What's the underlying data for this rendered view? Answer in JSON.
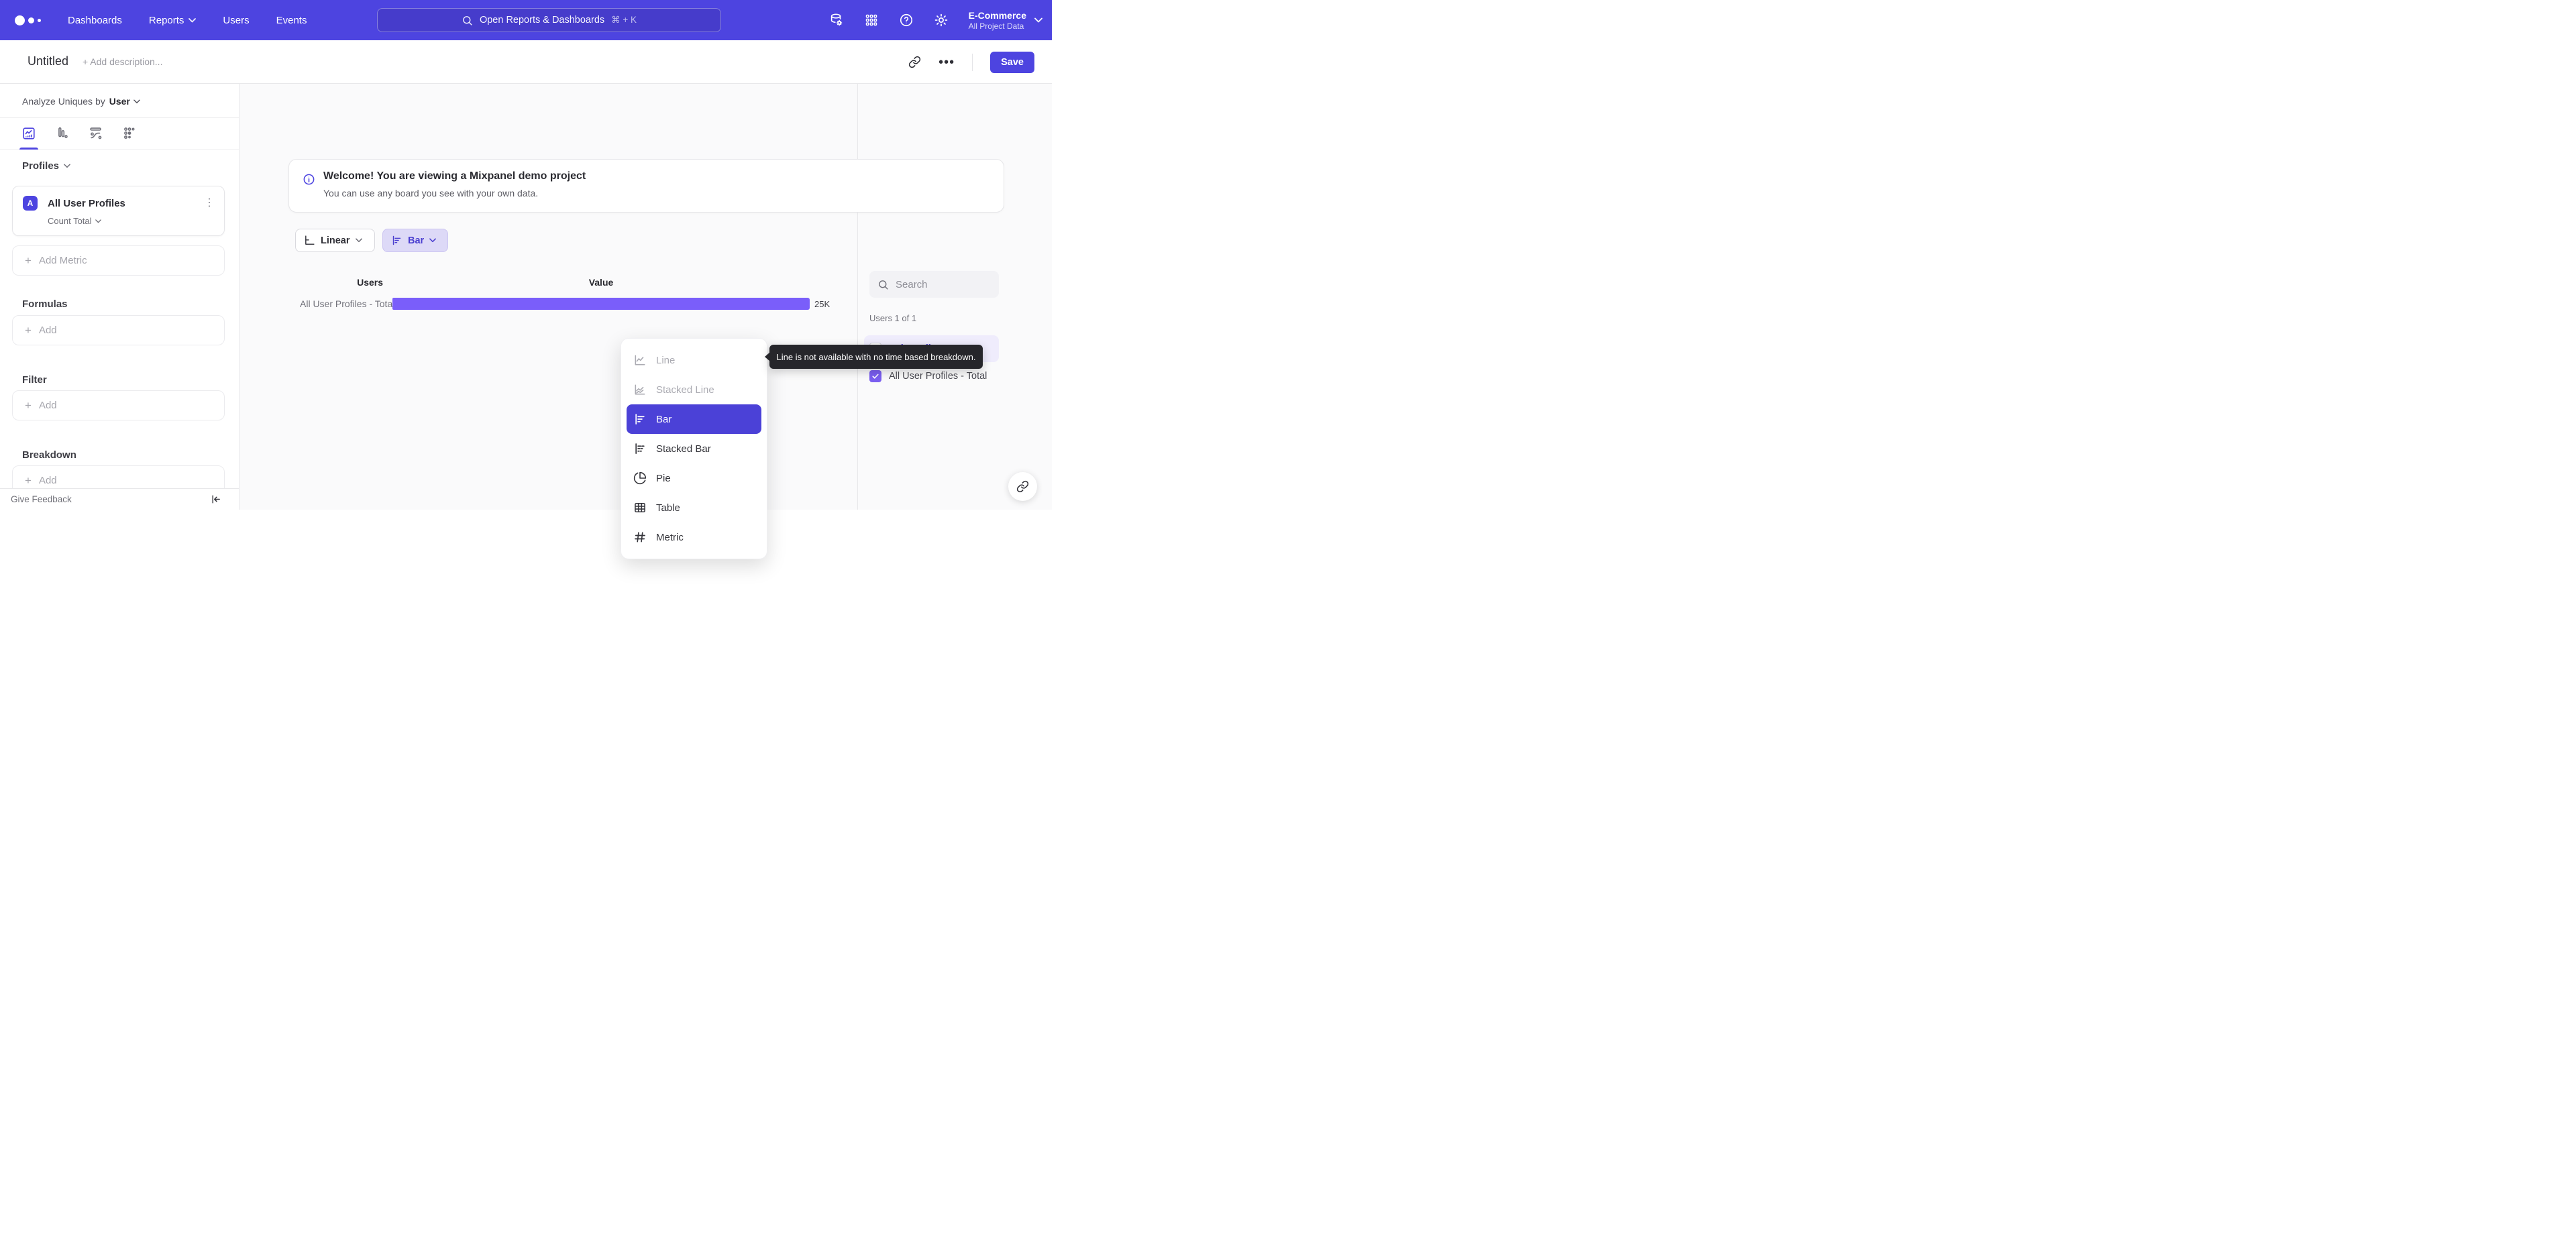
{
  "nav": {
    "items": [
      {
        "label": "Dashboards"
      },
      {
        "label": "Reports"
      },
      {
        "label": "Users"
      },
      {
        "label": "Events"
      }
    ],
    "search": {
      "placeholder": "Open Reports & Dashboards",
      "shortcut": "⌘ + K"
    },
    "project": {
      "name": "E-Commerce",
      "scope": "All Project Data"
    }
  },
  "header": {
    "title": "Untitled",
    "add_description": "+ Add description...",
    "more_label": "•••",
    "save_label": "Save"
  },
  "sidebar": {
    "analyze_prefix": "Analyze Uniques by",
    "analyze_selected": "User",
    "profiles_heading": "Profiles",
    "metric": {
      "letter": "A",
      "name": "All User Profiles",
      "aggregation": "Count Total",
      "kebab": "⋮"
    },
    "add_metric_label": "Add Metric",
    "plus": "+",
    "sections": [
      {
        "heading": "Formulas",
        "add_label": "Add"
      },
      {
        "heading": "Filter",
        "add_label": "Add"
      },
      {
        "heading": "Breakdown",
        "add_label": "Add"
      }
    ],
    "feedback_label": "Give Feedback"
  },
  "main": {
    "welcome": {
      "title": "Welcome! You are viewing a Mixpanel demo project",
      "subtitle": "You can use any board you see with your own data."
    },
    "controls": {
      "time_label": "Linear",
      "chart_label": "Bar"
    },
    "menu": {
      "items": [
        {
          "label": "Line",
          "icon": "line-chart-icon",
          "state": "disabled"
        },
        {
          "label": "Stacked Line",
          "icon": "stacked-line-chart-icon",
          "state": "disabled"
        },
        {
          "label": "Bar",
          "icon": "bar-chart-icon",
          "state": "selected"
        },
        {
          "label": "Stacked Bar",
          "icon": "stacked-bar-chart-icon",
          "state": "normal"
        },
        {
          "label": "Pie",
          "icon": "pie-chart-icon",
          "state": "normal"
        },
        {
          "label": "Table",
          "icon": "table-icon",
          "state": "normal"
        },
        {
          "label": "Metric",
          "icon": "hash-icon",
          "state": "normal"
        }
      ]
    },
    "tooltip": "Line is not available with no time based breakdown.",
    "chart_data": {
      "type": "bar",
      "orientation": "horizontal",
      "columns": [
        "Users",
        "Value"
      ],
      "categories": [
        "All User Profiles - Total"
      ],
      "values": [
        25000
      ],
      "value_labels": [
        "25K"
      ],
      "bar_color": "#7A5EFA",
      "grid": false,
      "legend": false
    }
  },
  "right_panel": {
    "search_placeholder": "Search",
    "count_label": "Users 1 of 1",
    "select_all_label": "Select all",
    "items": [
      {
        "label": "All User Profiles - Total",
        "checked": true
      }
    ]
  },
  "colors": {
    "nav_bg": "#4D44E0",
    "accent": "#4B41D7",
    "bar_fill": "#7A5EFA",
    "tooltip_bg": "#26262B"
  }
}
